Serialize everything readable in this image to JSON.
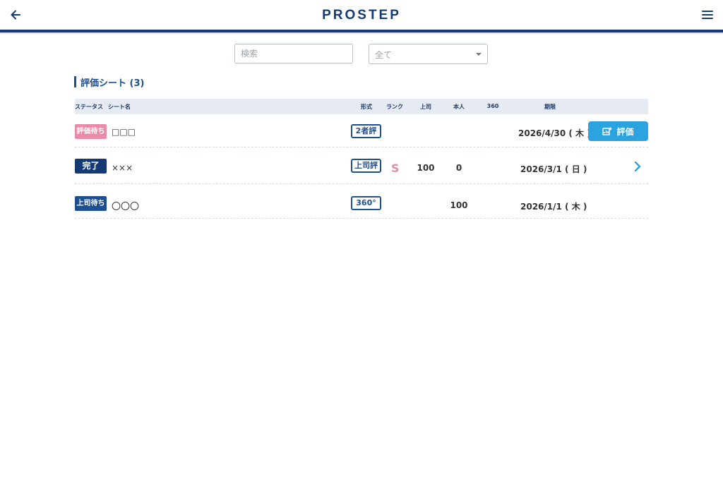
{
  "header": {
    "logo_text": "PROSTEP",
    "brand_color": "#143a74"
  },
  "filters": {
    "search_placeholder": "検索",
    "select_value": "全て"
  },
  "section": {
    "title": "評価シート (3)"
  },
  "table": {
    "columns": {
      "status": "ステータス",
      "name": "シート名",
      "type": "形式",
      "rank": "ランク",
      "boss": "上司",
      "self": "本人",
      "r360": "360",
      "deadline": "期限"
    },
    "rows": [
      {
        "status": "評価待ち",
        "status_color": "#e98aa9",
        "name": "□□□",
        "type": "2者評",
        "rank": "",
        "boss": "",
        "self": "",
        "r360": "",
        "deadline": "2026/4/30 ( 木 )",
        "action": "評価",
        "action_icon": "edit-chart-icon"
      },
      {
        "status": "完了",
        "status_color": "#143a74",
        "name": "×××",
        "type": "上司評",
        "rank": "S",
        "boss": "100",
        "self": "0",
        "r360": "",
        "deadline": "2026/3/1 ( 日 )",
        "action_icon": "chevron-right-icon"
      },
      {
        "status": "上司待ち",
        "status_color": "#1e4f8f",
        "name": "〇〇〇",
        "type": "360°",
        "rank": "",
        "boss": "",
        "self": "100",
        "r360": "",
        "deadline": "2026/1/1 ( 木 )"
      }
    ]
  }
}
